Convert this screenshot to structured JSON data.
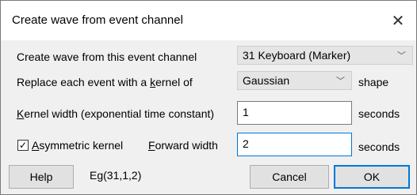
{
  "window": {
    "title": "Create wave from event channel",
    "close_icon": "close-icon"
  },
  "rows": {
    "channel": {
      "label": "Create wave from this event channel",
      "value": "31 Keyboard (Marker)"
    },
    "kernel": {
      "label_prefix": "Replace each event with a ",
      "label_accel": "k",
      "label_suffix": "ernel of",
      "value": "Gaussian",
      "unit": "shape"
    },
    "width": {
      "label_accel": "K",
      "label_rest": "ernel width (exponential time constant)",
      "value": "1",
      "unit": "seconds"
    },
    "asymmetric": {
      "checked": true,
      "label_accel": "A",
      "label_rest": "symmetric kernel",
      "forward_accel": "F",
      "forward_rest": "orward width",
      "value": "2",
      "unit": "seconds"
    }
  },
  "footer": {
    "help_label": "Help",
    "expression": "Eg(31,1,2)",
    "cancel_label": "Cancel",
    "ok_label": "OK"
  },
  "colors": {
    "focus_border": "#0078d7",
    "dialog_bg": "#f0f0f0"
  }
}
